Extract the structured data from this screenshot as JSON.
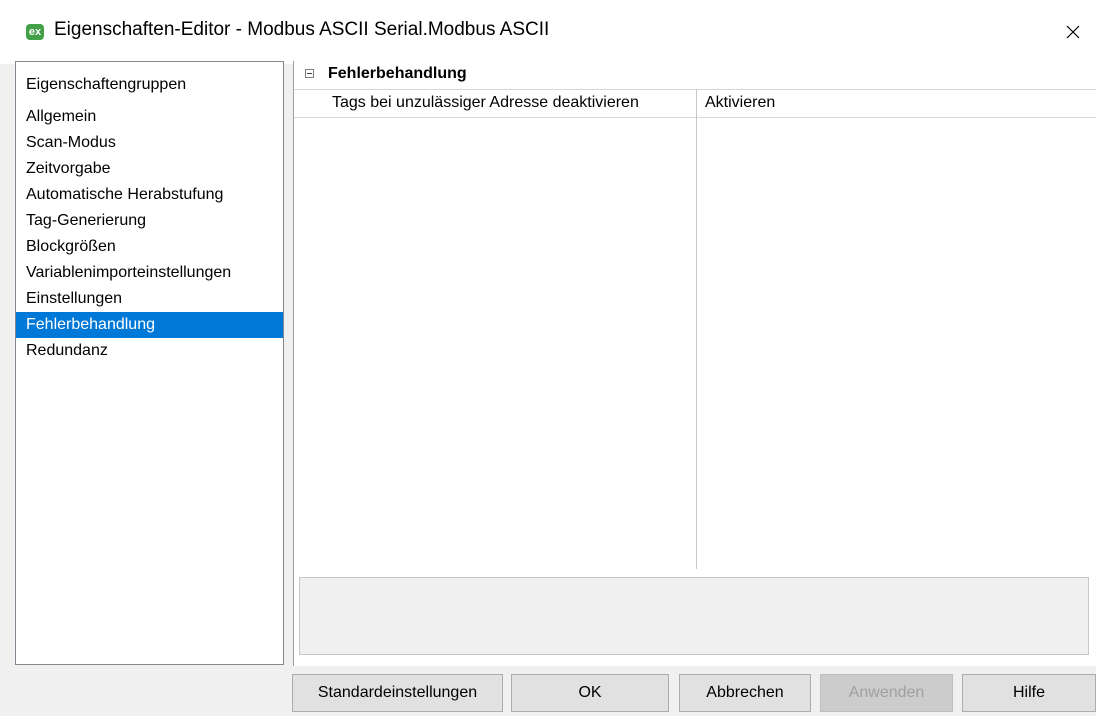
{
  "window": {
    "title": "Eigenschaften-Editor - Modbus ASCII Serial.Modbus ASCII",
    "icon_text": "ex"
  },
  "groups": {
    "header": "Eigenschaftengruppen",
    "items": [
      "Allgemein",
      "Scan-Modus",
      "Zeitvorgabe",
      "Automatische Herabstufung",
      "Tag-Generierung",
      "Blockgrößen",
      "Variablenimporteinstellungen",
      "Einstellungen",
      "Fehlerbehandlung",
      "Redundanz"
    ],
    "selected": "Fehlerbehandlung"
  },
  "properties": {
    "section_title": "Fehlerbehandlung",
    "rows": [
      {
        "name": "Tags bei unzulässiger Adresse deaktivieren",
        "value": "Aktivieren"
      }
    ]
  },
  "buttons": {
    "defaults": "Standardeinstellungen",
    "ok": "OK",
    "cancel": "Abbrechen",
    "apply": "Anwenden",
    "help": "Hilfe"
  },
  "colors": {
    "selection": "#0078d7",
    "app_icon": "#43a047"
  }
}
